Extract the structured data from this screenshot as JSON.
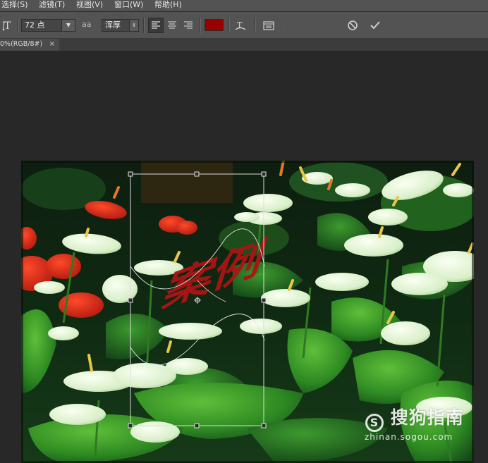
{
  "menu": {
    "items": [
      "选择(S)",
      "滤镜(T)",
      "视图(V)",
      "窗口(W)",
      "帮助(H)"
    ]
  },
  "options": {
    "font_size_value": "72 点",
    "antialias_label": "aa",
    "antialias_value": "浑厚",
    "text_color": "#990000",
    "cancel_icon": "cancel-icon",
    "commit_icon": "check-icon"
  },
  "document": {
    "tab_label": "0%(RGB/8#)",
    "tab_close": "×"
  },
  "canvas": {
    "warped_text": "案例",
    "text_color": "#aa1515"
  },
  "watermark": {
    "brand_text": "搜狗指南",
    "url": "zhinan.sogou.com"
  },
  "colors": {
    "menubar_bg": "#535353",
    "workspace_bg": "#282828",
    "selection_line": "#d8d8d8"
  }
}
